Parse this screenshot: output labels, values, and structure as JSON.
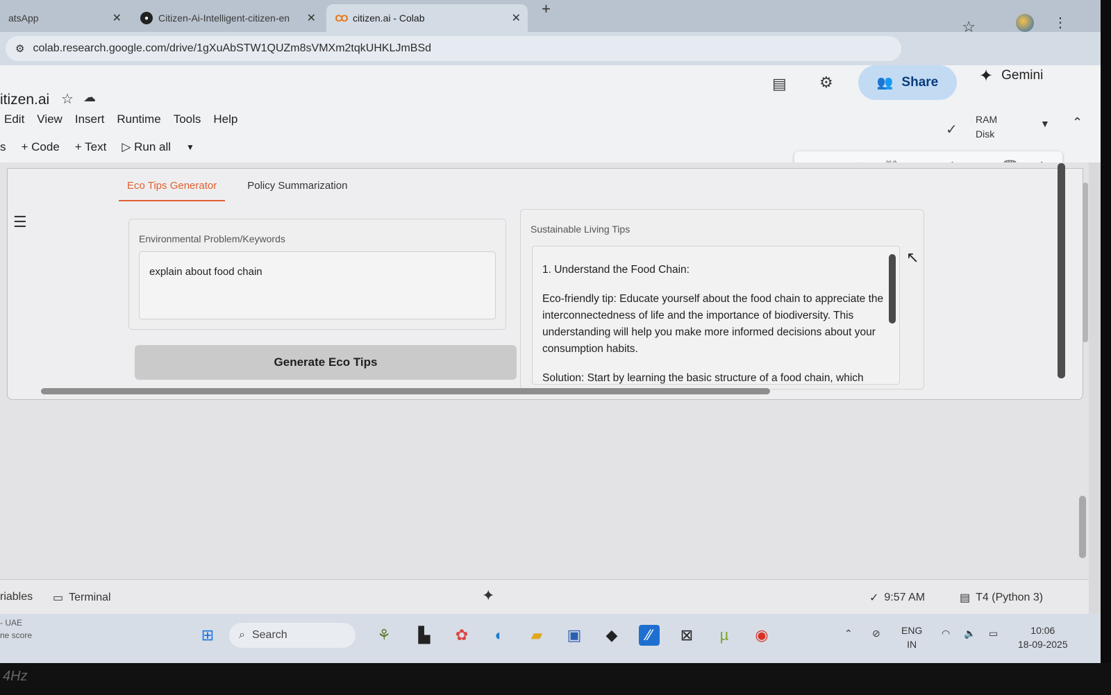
{
  "browser": {
    "tabs": [
      {
        "title": "atsApp",
        "icon": "whatsapp-icon"
      },
      {
        "title": "Citizen-Ai-Intelligent-citizen-en",
        "icon": "github-icon"
      },
      {
        "title": "citizen.ai - Colab",
        "icon": "colab-icon"
      }
    ],
    "url": "colab.research.google.com/drive/1gXuAbSTW1QUZm8sVMXm2tqkUHKLJmBSd"
  },
  "colab": {
    "notebook_title": "itizen.ai",
    "menu": [
      "Edit",
      "View",
      "Insert",
      "Runtime",
      "Tools",
      "Help"
    ],
    "toolbar": {
      "code": "Code",
      "text": "Text",
      "run_all": "Run all",
      "left_cut": "s"
    },
    "share_label": "Share",
    "gemini_label": "Gemini",
    "ram_label": "RAM",
    "disk_label": "Disk"
  },
  "app": {
    "tabs": [
      "Eco Tips Generator",
      "Policy Summarization"
    ],
    "active_tab": 0,
    "input_label": "Environmental Problem/Keywords",
    "input_value": "explain about food chain",
    "button_label": "Generate Eco Tips",
    "output_label": "Sustainable Living Tips",
    "output_lines": [
      "1. Understand the Food Chain:",
      "Eco-friendly tip: Educate yourself about the food chain to appreciate the interconnectedness of life and the importance of biodiversity. This understanding will help you make more informed decisions about your consumption habits.",
      "Solution: Start by learning the basic structure of a food chain, which"
    ]
  },
  "statusbar": {
    "variables": "riables",
    "terminal": "Terminal",
    "time": "9:57 AM",
    "runtime": "T4 (Python 3)"
  },
  "taskbar": {
    "weather_line1": "- UAE",
    "weather_line2": "ne score",
    "search_placeholder": "Search",
    "lang_line1": "ENG",
    "lang_line2": "IN",
    "clock_time": "10:06",
    "clock_date": "18-09-2025"
  },
  "bezel_text": "4Hz"
}
